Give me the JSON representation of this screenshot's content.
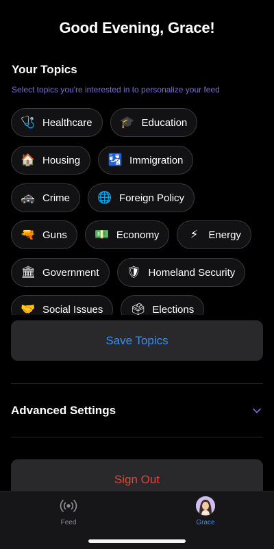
{
  "header": {
    "greeting": "Good Evening, Grace!"
  },
  "topics": {
    "title": "Your Topics",
    "subtitle": "Select topics you're interested in to personalize your feed",
    "items": [
      {
        "label": "Healthcare",
        "icon": "stethoscope-icon",
        "glyph": "🩺"
      },
      {
        "label": "Education",
        "icon": "graduation-cap-icon",
        "glyph": "🎓"
      },
      {
        "label": "Housing",
        "icon": "house-icon",
        "glyph": "🏠"
      },
      {
        "label": "Immigration",
        "icon": "passport-control-icon",
        "glyph": "🛂"
      },
      {
        "label": "Crime",
        "icon": "police-car-icon",
        "glyph": "🚓"
      },
      {
        "label": "Foreign Policy",
        "icon": "globe-icon",
        "glyph": "🌐"
      },
      {
        "label": "Guns",
        "icon": "water-pistol-icon",
        "glyph": "🔫"
      },
      {
        "label": "Economy",
        "icon": "dollar-banknote-icon",
        "glyph": "💵"
      },
      {
        "label": "Energy",
        "icon": "lightning-icon",
        "glyph": "⚡"
      },
      {
        "label": "Government",
        "icon": "classical-building-icon",
        "glyph": "🏛"
      },
      {
        "label": "Homeland Security",
        "icon": "shield-icon",
        "glyph": "🛡"
      },
      {
        "label": "Social Issues",
        "icon": "handshake-icon",
        "glyph": "🤝"
      },
      {
        "label": "Elections",
        "icon": "ballot-box-icon",
        "glyph": "🗳"
      }
    ],
    "save_label": "Save Topics"
  },
  "settings": {
    "advanced_label": "Advanced Settings",
    "advanced_icon": "chevron-down-icon"
  },
  "account": {
    "signout_label": "Sign Out"
  },
  "tabbar": {
    "feed_label": "Feed",
    "feed_icon": "broadcast-icon",
    "grace_label": "Grace",
    "grace_icon": "avatar-icon",
    "active_tab": "Grace"
  },
  "colors": {
    "accent": "#3b8ef0",
    "subtitle": "#7b6bd9",
    "danger": "#e5443a",
    "background": "#000000"
  }
}
